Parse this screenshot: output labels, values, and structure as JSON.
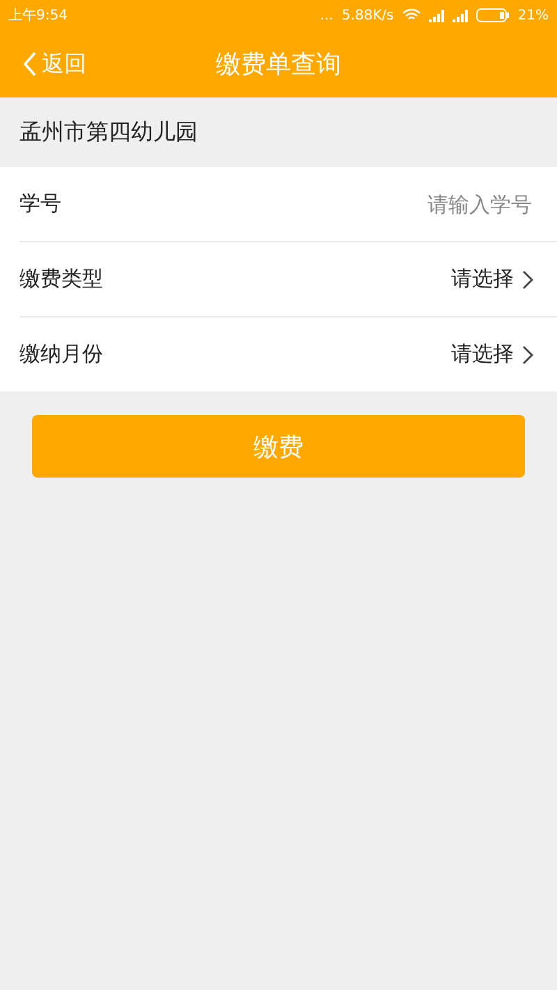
{
  "status_bar": {
    "time": "上午9:54",
    "dots": "...",
    "speed": "5.88K/s",
    "battery": "21%"
  },
  "nav": {
    "back": "返回",
    "title": "缴费单查询"
  },
  "school": "孟州市第四幼儿园",
  "rows": [
    {
      "kind": "input",
      "label": "学号",
      "placeholder": "请输入学号"
    },
    {
      "kind": "select",
      "label": "缴费类型",
      "value": "请选择"
    },
    {
      "kind": "select",
      "label": "缴纳月份",
      "value": "请选择"
    }
  ],
  "button": "缴费"
}
